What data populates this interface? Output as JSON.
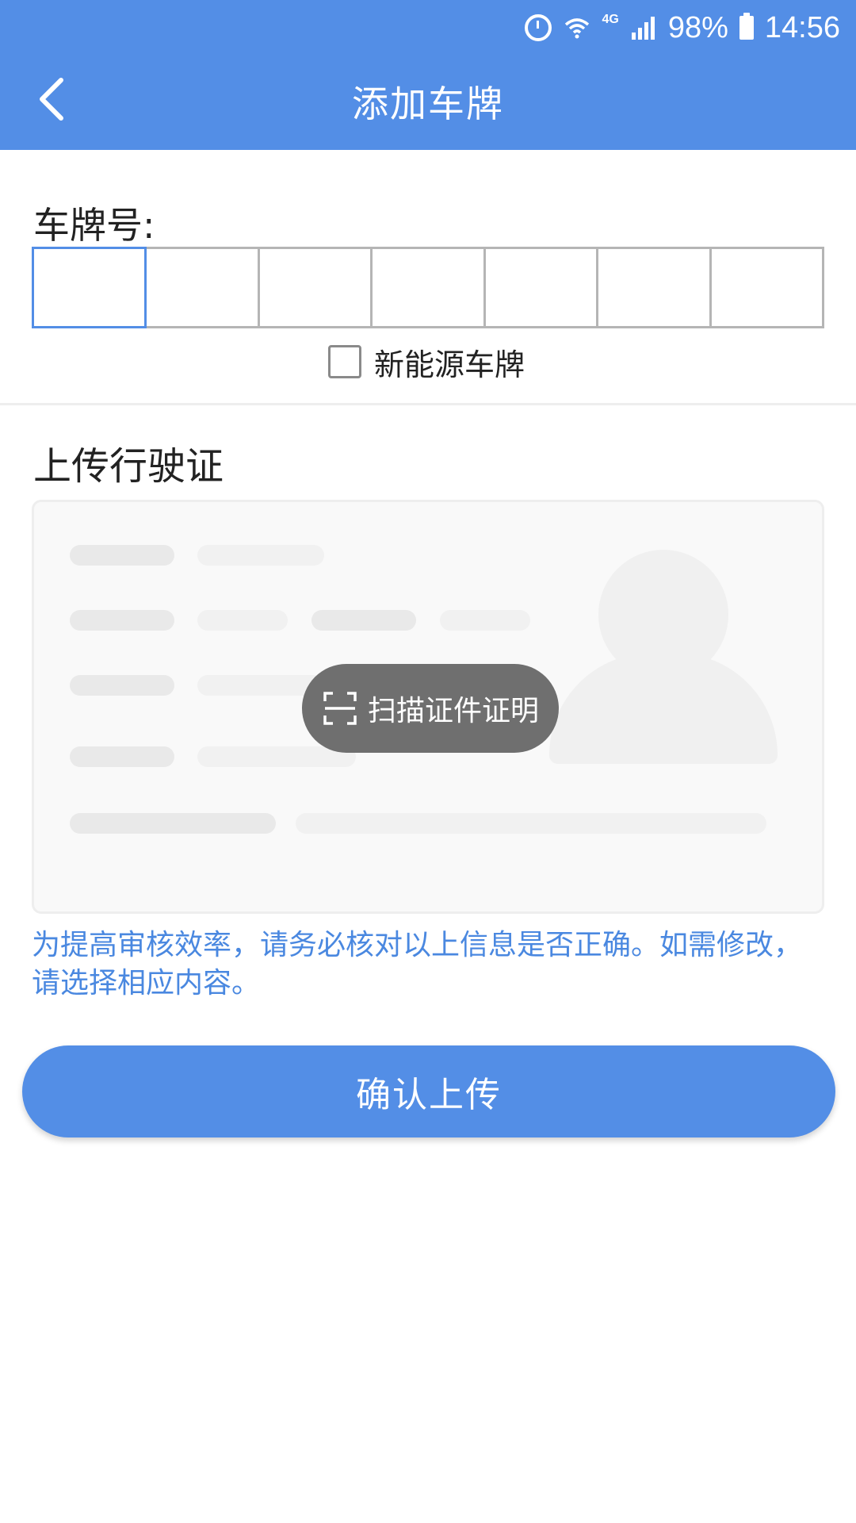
{
  "status_bar": {
    "battery": "98%",
    "time": "14:56",
    "network": "4G"
  },
  "header": {
    "title": "添加车牌",
    "back_icon": "chevron-left-icon"
  },
  "plate": {
    "label": "车牌号:",
    "boxes": [
      "",
      "",
      "",
      "",
      "",
      "",
      ""
    ],
    "new_energy_label": "新能源车牌",
    "new_energy_checked": false
  },
  "upload": {
    "title": "上传行驶证",
    "scan_label": "扫描证件证明",
    "scan_icon": "scan-frame-icon"
  },
  "hint": "为提高审核效率，请务必核对以上信息是否正确。如需修改，请选择相应内容。",
  "confirm_label": "确认上传",
  "colors": {
    "primary": "#538ee6",
    "hint_text": "#4a88e0",
    "scan_button": "#6f6f6f"
  }
}
